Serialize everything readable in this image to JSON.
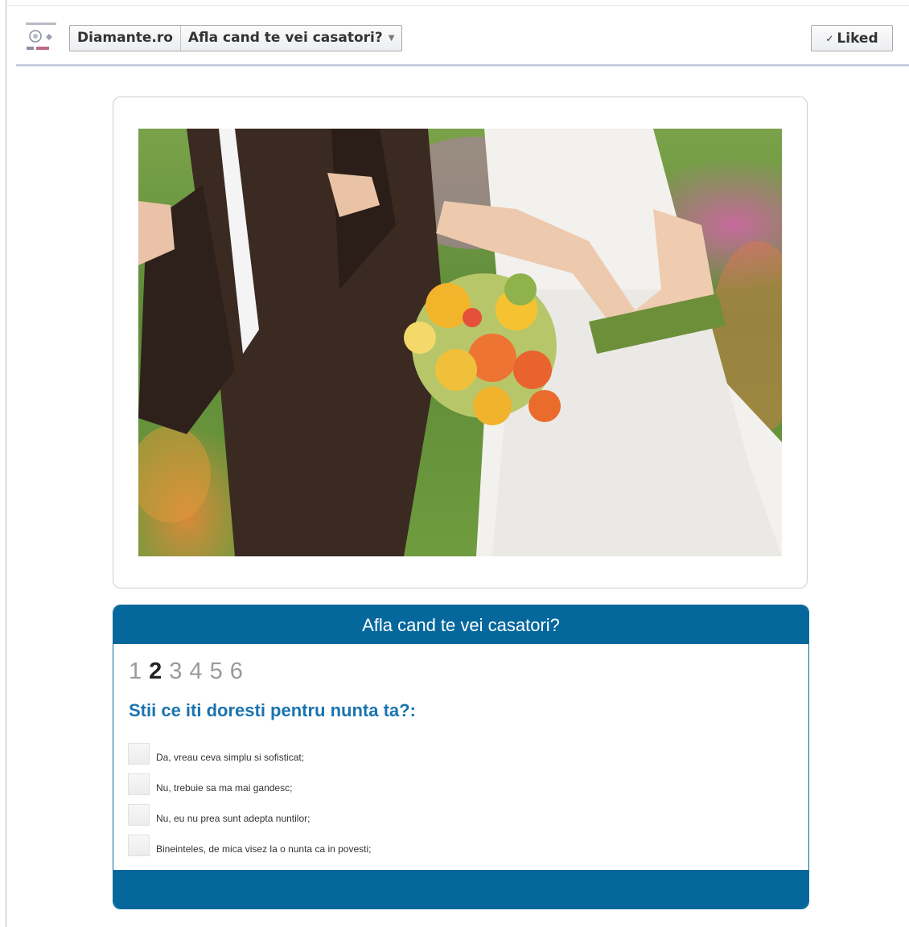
{
  "header": {
    "page_name": "Diamante.ro",
    "app_name": "Afla cand te vei casatori?",
    "liked_label": "Liked"
  },
  "quiz": {
    "title": "Afla cand te vei casatori?",
    "steps": [
      "1",
      "2",
      "3",
      "4",
      "5",
      "6"
    ],
    "current_step": "2",
    "question": "Stii ce iti doresti pentru nunta ta?:",
    "options": [
      "Da, vreau ceva simplu si sofisticat;",
      "Nu, trebuie sa ma mai gandesc;",
      "Nu, eu nu prea sunt adepta nuntilor;",
      "Bineinteles, de mica visez la o nunta ca in povesti;"
    ]
  },
  "colors": {
    "accent_blue": "#06679c",
    "question_blue": "#1a74b0"
  }
}
